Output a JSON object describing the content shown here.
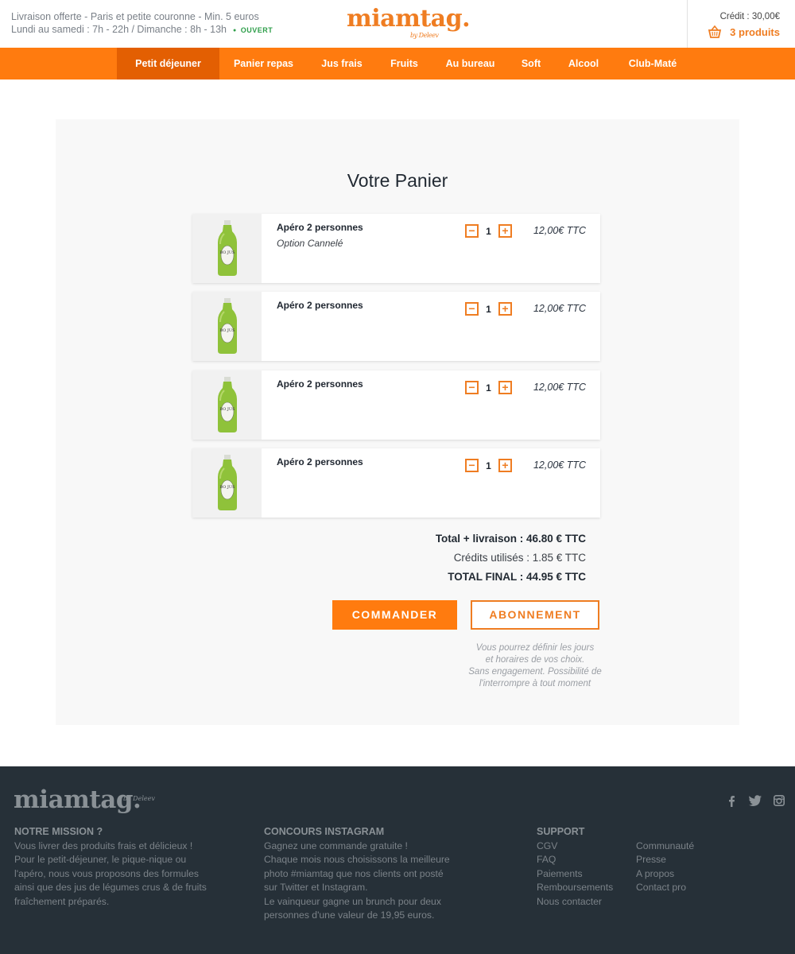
{
  "topbar": {
    "delivery_line": "Livraison offerte - Paris et petite couronne - Min. 5 euros",
    "hours_line": "Lundi au samedi : 7h - 22h / Dimanche : 8h - 13h",
    "open_status": "OUVERT",
    "logo": "miamtag.",
    "logo_by": "by Deleev",
    "credit": "Crédit : 30,00€",
    "cart_count": "3 produits"
  },
  "nav": {
    "items": [
      {
        "label": "Petit déjeuner"
      },
      {
        "label": "Panier repas"
      },
      {
        "label": "Jus frais"
      },
      {
        "label": "Fruits"
      },
      {
        "label": "Au bureau"
      },
      {
        "label": "Soft"
      },
      {
        "label": "Alcool"
      },
      {
        "label": "Club-Maté"
      }
    ]
  },
  "cart": {
    "title": "Votre Panier",
    "items": [
      {
        "name": "Apéro 2 personnes",
        "option": "Option Cannelé",
        "qty": "1",
        "price": "12,00€ TTC",
        "label_text": "BO JUS"
      },
      {
        "name": "Apéro 2 personnes",
        "option": "",
        "qty": "1",
        "price": "12,00€ TTC",
        "label_text": "BO JUS"
      },
      {
        "name": "Apéro 2 personnes",
        "option": "",
        "qty": "1",
        "price": "12,00€ TTC",
        "label_text": "BO JUS"
      },
      {
        "name": "Apéro 2 personnes",
        "option": "",
        "qty": "1",
        "price": "12,00€ TTC",
        "label_text": "BO JUS"
      }
    ],
    "minus": "−",
    "plus": "+",
    "total_delivery": "Total + livraison : 46.80 € TTC",
    "credits_used": "Crédits utilisés : 1.85 € TTC",
    "total_final": "TOTAL FINAL : 44.95 € TTC",
    "btn_order": "COMMANDER",
    "btn_subscribe": "ABONNEMENT",
    "note": [
      "Vous pourrez définir les jours",
      "et horaires de vos choix.",
      "Sans engagement. Possibilité de",
      "l'interrompre à tout moment"
    ]
  },
  "footer": {
    "logo": "miamtag.",
    "logo_by": "by Deleev",
    "social": {
      "facebook": "f",
      "twitter": "t",
      "instagram": "◘"
    },
    "mission": {
      "title": "NOTRE MISSION ?",
      "lines": [
        "Vous livrer des produits frais et délicieux !",
        "Pour le petit-déjeuner, le pique-nique ou",
        "l'apéro, nous vous proposons des formules",
        "ainsi que des jus de légumes crus & de fruits",
        "fraîchement préparés."
      ]
    },
    "instagram": {
      "title": "CONCOURS INSTAGRAM",
      "lines": [
        "Gagnez une commande gratuite !",
        "Chaque mois nous choisissons la meilleure",
        "photo #miamtag que nos clients ont posté",
        "sur Twitter et Instagram.",
        "Le vainqueur gagne un brunch pour deux",
        "personnes d'une valeur de 19,95 euros."
      ]
    },
    "support": {
      "title": "SUPPORT",
      "col1": [
        "CGV",
        "FAQ",
        "Paiements",
        "Remboursements",
        "Nous contacter"
      ],
      "col2": [
        "Communauté",
        "Presse",
        "A propos",
        "Contact pro"
      ]
    }
  },
  "colors": {
    "accent": "#ff7b0f",
    "accent_dark": "#e35f02",
    "footer_bg": "#263038",
    "open_green": "#2e9e4a"
  }
}
